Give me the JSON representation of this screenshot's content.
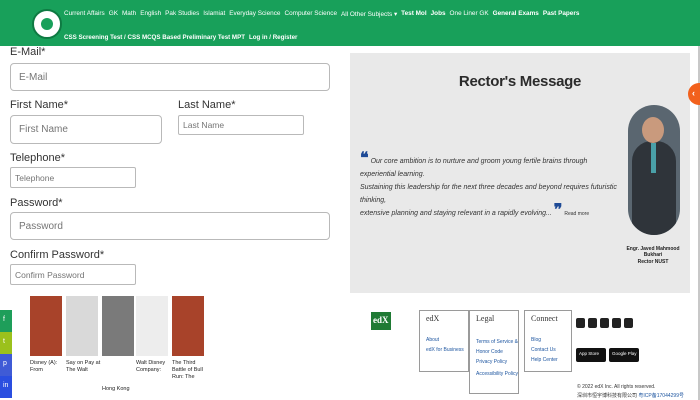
{
  "header": {
    "nav_primary": [
      "Current Affairs",
      "GK",
      "Math",
      "English",
      "Pak Studies",
      "Islamiat",
      "Everyday Science",
      "Computer Science",
      "All Other Subjects ▾",
      "Test Mol",
      "Jobs",
      "One Liner GK",
      "General Exams",
      "Past Papers"
    ],
    "nav_secondary": [
      "CSS Screening Test / CSS MCQS Based Preliminary Test MPT",
      "Log in / Register"
    ]
  },
  "form": {
    "email_label": "E-Mail*",
    "email_placeholder": "E-Mail",
    "first_name_label": "First Name*",
    "first_name_placeholder": "First Name",
    "last_name_label": "Last Name*",
    "last_name_placeholder": "Last Name",
    "telephone_label": "Telephone*",
    "telephone_placeholder": "Telephone",
    "password_label": "Password*",
    "password_placeholder": "Password",
    "confirm_label": "Confirm Password*",
    "confirm_placeholder": "Confirm Password"
  },
  "thumbnails": [
    {
      "caption": "Disney (A): From",
      "color": "#a8432a"
    },
    {
      "caption": "Say on Pay at The Walt",
      "color": "#d9d9d9"
    },
    {
      "caption": "Hong Kong",
      "color": "#7a7a7a"
    },
    {
      "caption": "Walt Disney Company:",
      "color": "#ededed"
    },
    {
      "caption": "The Third Battle of Bull Run: The",
      "color": "#a8432a"
    }
  ],
  "side_tabs": [
    {
      "icon": "f",
      "color": "#1e9e5a"
    },
    {
      "icon": "t",
      "color": "#9bc11c"
    },
    {
      "icon": "p",
      "color": "#3f5bd6"
    },
    {
      "icon": "in",
      "color": "#2a4ee0"
    }
  ],
  "rector": {
    "title": "Rector's Message",
    "quote_lines": [
      "Our core ambition is to nurture and groom young fertile brains through experiential learning.",
      "Sustaining this leadership for the next three decades and beyond requires futuristic thinking,",
      "extensive planning and staying relevant in a rapidly evolving..."
    ],
    "read_more": "Read more",
    "name": "Engr. Javed Mahmood Bukhari",
    "role": "Rector NUST"
  },
  "footer": {
    "logo_text": "edX",
    "col_edx": {
      "title": "edX",
      "links": [
        "About",
        "edX for Business"
      ]
    },
    "col_legal": {
      "title": "Legal",
      "links": [
        "Terms of Service & Honor Code",
        "Privacy Policy",
        "Accessibility Policy"
      ]
    },
    "col_connect": {
      "title": "Connect",
      "links": [
        "Blog",
        "Contact Us",
        "Help Center"
      ]
    },
    "app_store": "App Store",
    "google_play": "Google Play",
    "copyright": "© 2022 edX Inc. All rights reserved.",
    "icp": "深圳市恒宇博科技有限公司",
    "icp_link": "粤ICP备17044299号"
  }
}
